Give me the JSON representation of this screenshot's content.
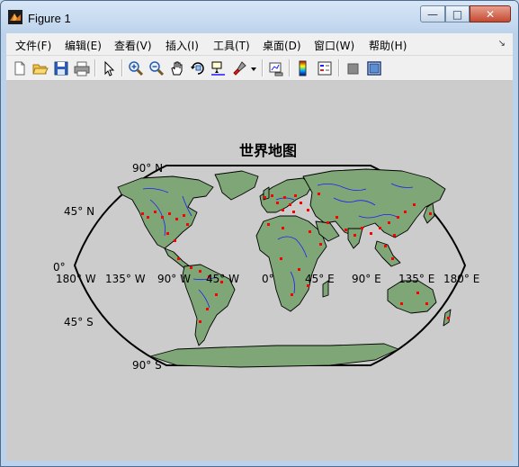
{
  "window": {
    "title": "Figure 1",
    "controls": {
      "minimize": "—",
      "maximize": "□",
      "close": "✕"
    }
  },
  "menubar": {
    "items": [
      {
        "label": "文件(F)"
      },
      {
        "label": "编辑(E)"
      },
      {
        "label": "查看(V)"
      },
      {
        "label": "插入(I)"
      },
      {
        "label": "工具(T)"
      },
      {
        "label": "桌面(D)"
      },
      {
        "label": "窗口(W)"
      },
      {
        "label": "帮助(H)"
      }
    ],
    "overflow_icon": "arrow-icon"
  },
  "toolbar": {
    "buttons": [
      {
        "icon": "new-figure-icon"
      },
      {
        "icon": "open-file-icon"
      },
      {
        "icon": "save-icon"
      },
      {
        "icon": "print-icon"
      },
      {
        "icon": "edit-plot-icon"
      },
      {
        "icon": "zoom-in-icon"
      },
      {
        "icon": "zoom-out-icon"
      },
      {
        "icon": "pan-icon"
      },
      {
        "icon": "rotate-3d-icon"
      },
      {
        "icon": "data-cursor-icon"
      },
      {
        "icon": "brush-icon"
      },
      {
        "icon": "link-plot-icon"
      },
      {
        "icon": "colorbar-icon"
      },
      {
        "icon": "legend-icon"
      },
      {
        "icon": "hide-plot-tools-icon"
      },
      {
        "icon": "show-plot-tools-icon"
      }
    ]
  },
  "map": {
    "title": "世界地图",
    "lat_labels": [
      "90° N",
      "45° N",
      "0°",
      "45° S",
      "90° S"
    ],
    "lon_labels": [
      "180° W",
      "135° W",
      "90° W",
      "45° W",
      "0°",
      "45° E",
      "90° E",
      "135° E",
      "180° E"
    ],
    "colors": {
      "land": "#7fa676",
      "coast": "#000000",
      "rivers": "#1c1cff",
      "cities": "#ff0000",
      "background": "#cccccc"
    }
  }
}
